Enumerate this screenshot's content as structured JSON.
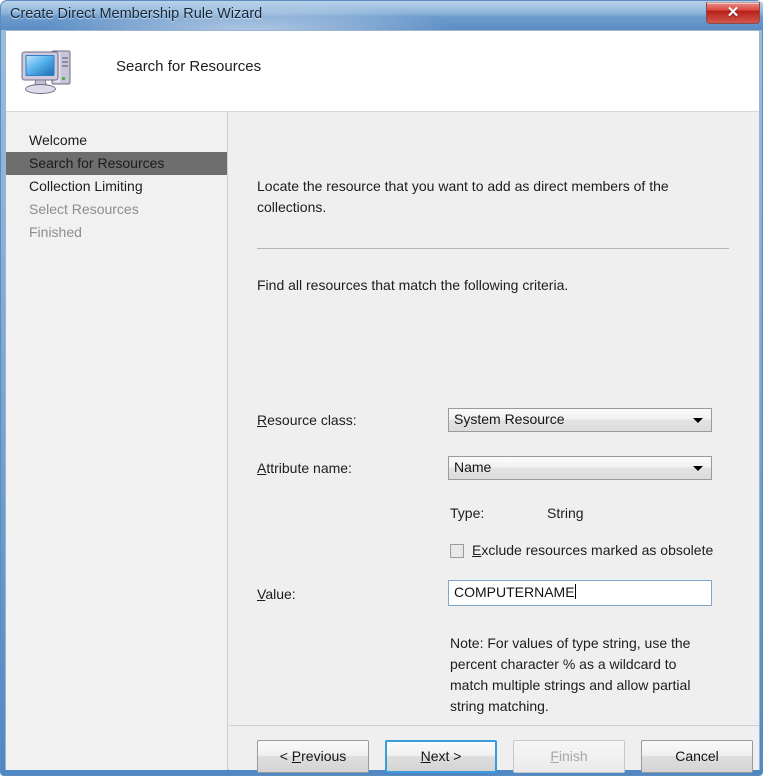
{
  "window": {
    "title": "Create Direct Membership Rule Wizard",
    "close_label": "✕",
    "close_icon": "close-icon"
  },
  "header": {
    "icon": "computer-icon",
    "title": "Search for Resources"
  },
  "sidebar": {
    "items": [
      {
        "label": "Welcome",
        "state": "normal"
      },
      {
        "label": "Search for Resources",
        "state": "selected"
      },
      {
        "label": "Collection Limiting",
        "state": "normal"
      },
      {
        "label": "Select Resources",
        "state": "disabled"
      },
      {
        "label": "Finished",
        "state": "disabled"
      }
    ]
  },
  "main": {
    "intro": "Locate the resource that you want to add as direct members of the collections.",
    "criteria_heading": "Find all resources that match the following criteria.",
    "resource_class": {
      "label_pre": "R",
      "label_post": "esource class:",
      "value": "System Resource"
    },
    "attribute_name": {
      "label_pre": "A",
      "label_post": "ttribute name:",
      "value": "Name"
    },
    "type": {
      "label": "Type:",
      "value": "String"
    },
    "exclude_obsolete": {
      "label_pre": "E",
      "label_post": "xclude resources marked as obsolete",
      "checked": false
    },
    "value_field": {
      "label_pre": "V",
      "label_post": "alue:",
      "value": "COMPUTERNAME"
    },
    "note": "Note: For values of type string, use the percent character % as a wildcard to match multiple strings and allow partial string matching."
  },
  "footer": {
    "previous": {
      "pre": "< ",
      "acc": "P",
      "post": "revious"
    },
    "next": {
      "pre": "",
      "acc": "N",
      "post": "ext >"
    },
    "finish": {
      "pre": "",
      "acc": "F",
      "post": "inish"
    },
    "cancel": {
      "pre": "",
      "acc": "",
      "post": "Cancel"
    }
  },
  "colors": {
    "titlebar_blue": "#6c9bcd",
    "close_red": "#d9453c",
    "selected_nav": "#6e6e6e",
    "focus_border": "#3c9bdb",
    "panel_bg": "#efefef"
  }
}
